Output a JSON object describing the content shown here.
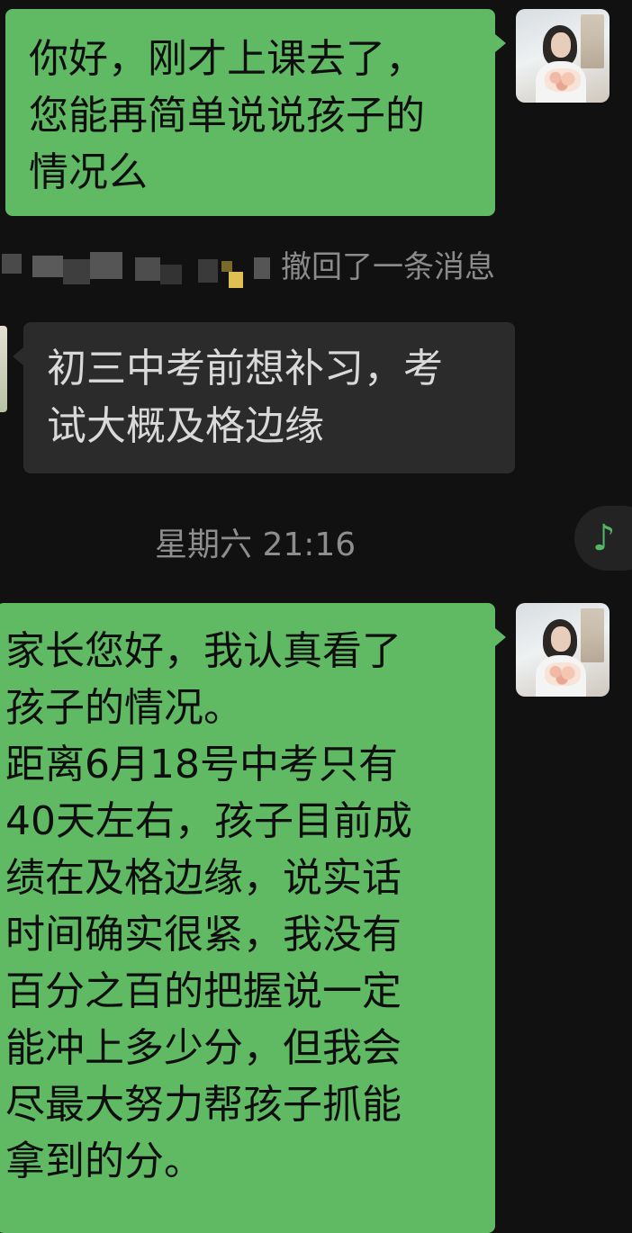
{
  "messages": [
    {
      "side": "right",
      "text": "你好，刚才上课去了，\n您能再简单说说孩子的\n情况么"
    },
    {
      "side": "system",
      "text": "撤回了一条消息"
    },
    {
      "side": "left",
      "text": "初三中考前想补习，考\n试大概及格边缘"
    },
    {
      "side": "right",
      "text": "家长您好，我认真看了\n孩子的情况。\n距离6月18号中考只有\n40天左右，孩子目前成\n绩在及格边缘，说实话\n时间确实很紧，我没有\n百分之百的把握说一定\n能冲上多少分，但我会\n尽最大努力帮孩子抓能\n拿到的分。"
    }
  ],
  "timestamp": "星期六 21:16",
  "music_icon": "♪",
  "colors": {
    "background": "#111111",
    "sent_bubble": "#60b963",
    "received_bubble": "#2b2b2b",
    "accent_music": "#52b865"
  }
}
